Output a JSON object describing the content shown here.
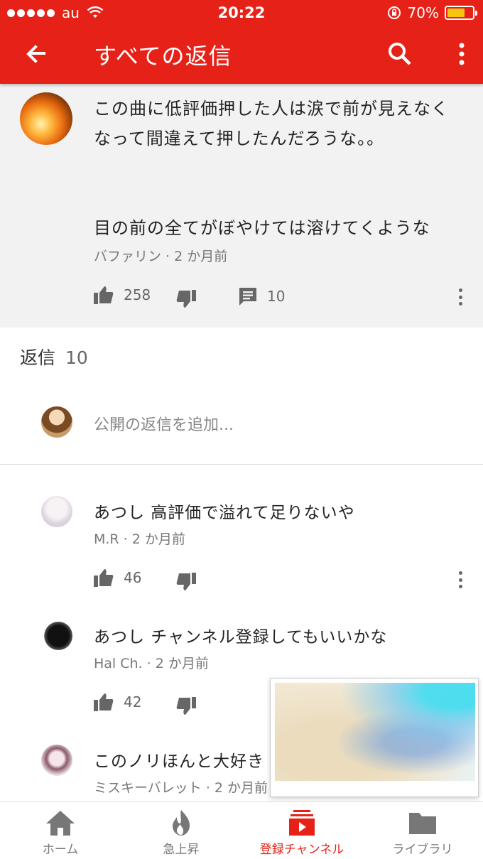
{
  "status_bar": {
    "carrier": "au",
    "time": "20:22",
    "battery": "70%",
    "battery_level": 0.7
  },
  "appbar": {
    "title": "すべての返信"
  },
  "parent_comment": {
    "text": "この曲に低評価押した人は涙で前が見えなく\nなって間違えて押したんだろうな。。\n\n\n目の前の全てがぼやけては溶けてくような",
    "author": "バファリン",
    "time_ago": "2 か月前",
    "meta": "バファリン · 2 か月前",
    "likes": "258",
    "replies": "10"
  },
  "replies_section": {
    "label": "返信",
    "count": "10",
    "add_placeholder": "公開の返信を追加..."
  },
  "replies": [
    {
      "text": "あつし 高評価で溢れて足りないや",
      "meta": "M.R · 2 か月前",
      "likes": "46"
    },
    {
      "text": "あつし チャンネル登録してもいいかな",
      "meta": "Hal Ch. · 2 か月前",
      "likes": "42"
    },
    {
      "text": "このノリほんと大好き",
      "meta": "ミスキーバレット · 2 か月前"
    }
  ],
  "bottom_nav": {
    "home": "ホーム",
    "trending": "急上昇",
    "subscriptions": "登録チャンネル",
    "library": "ライブラリ"
  },
  "colors": {
    "brand_red": "#e62117",
    "battery_yellow": "#f5c60d"
  },
  "icons": [
    "back-arrow-icon",
    "search-icon",
    "more-vert-icon",
    "thumb-up-icon",
    "thumb-down-icon",
    "comment-icon",
    "home-icon",
    "flame-icon",
    "subscriptions-icon",
    "folder-icon"
  ]
}
